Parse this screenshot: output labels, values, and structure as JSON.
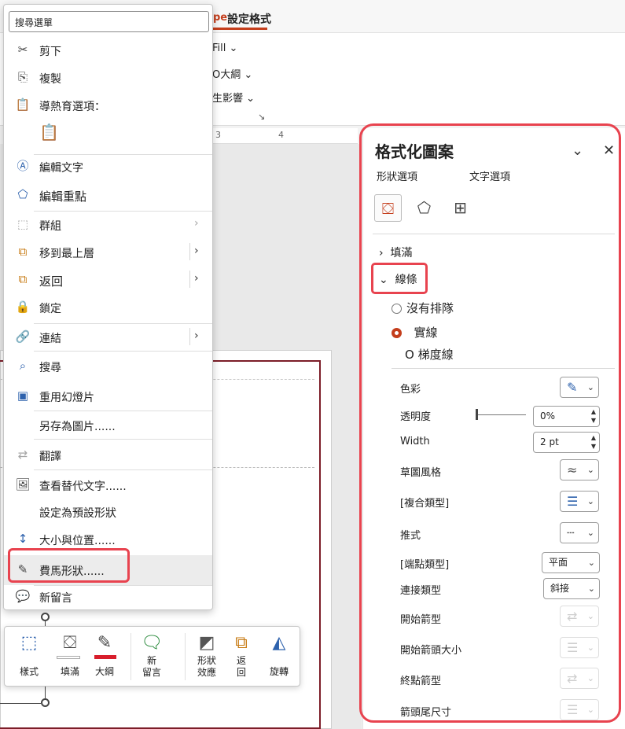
{
  "ribbon": {
    "tab_active": "設定格式",
    "tab_partial": "pe",
    "fill": "Fill ⌄",
    "outline": "O大綱 ⌄",
    "effects": "生影響 ⌄"
  },
  "ruler": {
    "mark3": "3",
    "mark4": "4"
  },
  "context_menu": {
    "search_value": "搜尋選單",
    "items": [
      {
        "label": "剪下",
        "icon": "scissors-icon"
      },
      {
        "label": "複製",
        "icon": "copy-icon"
      },
      {
        "label": "導熱育選項：",
        "icon": "paste-icon"
      },
      {
        "label": "編輯文字",
        "icon": "edit-text-icon"
      },
      {
        "label": "編輯重點",
        "icon": "edit-points-icon"
      },
      {
        "label": "群組",
        "icon": "group-icon"
      },
      {
        "label": "移到最上層",
        "icon": "bring-to-front-icon"
      },
      {
        "label": "返回",
        "icon": "send-backward-icon"
      },
      {
        "label": "鎖定",
        "icon": "lock-icon"
      },
      {
        "label": "連結",
        "icon": "link-icon"
      },
      {
        "label": "搜尋",
        "icon": "search-icon"
      },
      {
        "label": "重用幻燈片",
        "icon": "reuse-slides-icon"
      },
      {
        "label": "另存為圖片......",
        "icon": ""
      },
      {
        "label": "翻譯",
        "icon": "translate-icon"
      },
      {
        "label": "查看替代文字......",
        "icon": "alt-text-icon"
      },
      {
        "label": "設定為預設形狀",
        "icon": ""
      },
      {
        "label": "大小與位置......",
        "icon": "size-position-icon"
      },
      {
        "label": "費馬形狀......",
        "icon": "format-shape-icon"
      },
      {
        "label": "新留言",
        "icon": "new-comment-icon"
      }
    ]
  },
  "mini_toolbar": {
    "style": "樣式",
    "fill": "填滿",
    "outline": "大綱",
    "new_comment_1": "新",
    "new_comment_2": "留言",
    "shape_effects_1": "形狀",
    "shape_effects_2": "效應",
    "back_1": "返",
    "back_2": "回",
    "rotate": "旋轉",
    "outline_color": "#d81e2c"
  },
  "format_pane": {
    "title": "格式化圖案",
    "tab_shape": "形狀選項",
    "tab_text": "文字選項",
    "section_fill": "填滿",
    "section_line": "線條",
    "line_options": {
      "none": "沒有排隊",
      "solid": "實線",
      "gradient": "O 梯度線"
    },
    "props": {
      "color": "色彩",
      "transparency": "透明度",
      "transparency_value": "0%",
      "width": "Width",
      "width_value": "2 pt",
      "sketch_style": "草圖風格",
      "compound_type": "[複合類型]",
      "dash_type": "推式",
      "cap_type": "[端點類型]",
      "cap_value": "平面",
      "join_type": "連接類型",
      "join_value": "斜接",
      "begin_arrow_type": "開始箭型",
      "begin_arrow_size": "開始箭頭大小",
      "end_arrow_type": "終點箭型",
      "end_arrow_size": "箭頭尾尺寸"
    },
    "accent": "#c43e1c"
  },
  "callout_color": "#e8434f"
}
